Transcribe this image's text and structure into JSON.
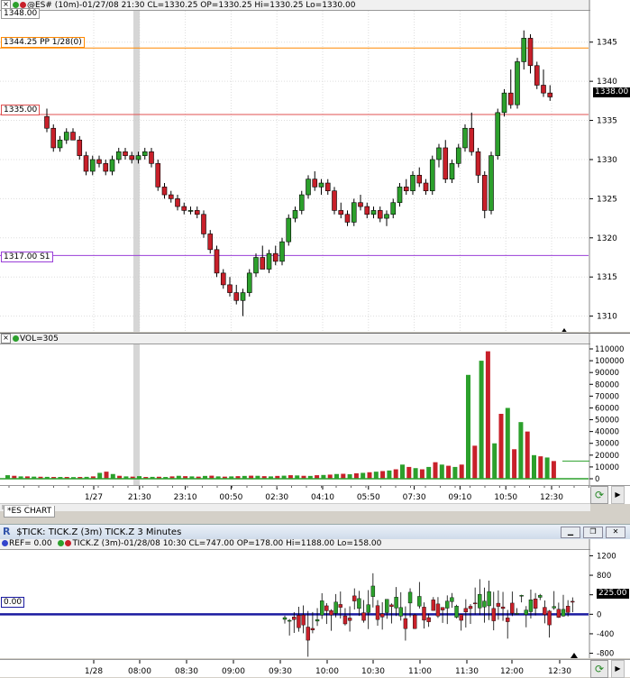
{
  "price_panel": {
    "top_label": "1348.00",
    "header": "@ES# (10m)-01/27/08 21:30 CL=1330.25 OP=1330.25 Hi=1330.25 Lo=1330.00",
    "pp_label": "1344.25 PP  1/28(0)",
    "l1335_label": "1335.00",
    "s1_label": "1317.00 S1",
    "current_price": "1338.00",
    "ticks": [
      "1345",
      "1340",
      "1335",
      "1330",
      "1325",
      "1320",
      "1315",
      "1310"
    ],
    "colors": {
      "up": "#2ca02c",
      "down": "#c8202a",
      "pp": "#ff8800",
      "level": "#e05050",
      "s1": "#9a3fd8"
    }
  },
  "volume_panel": {
    "header": "VOL=305",
    "ticks": [
      "110000",
      "100000",
      "90000",
      "80000",
      "70000",
      "60000",
      "50000",
      "40000",
      "30000",
      "20000",
      "10000",
      "0"
    ],
    "current": "15000"
  },
  "time_axis_1": [
    "1/27",
    "21:30",
    "23:10",
    "00:50",
    "02:30",
    "04:10",
    "05:50",
    "07:30",
    "09:10",
    "10:50",
    "12:30"
  ],
  "chart_tab": "*ES CHART",
  "tick_window": {
    "title": "$TICK: TICK.Z (3m) TICK.Z 3 Minutes",
    "header_ref": "REF= 0.00",
    "header": "TICK.Z (3m)-01/28/08 10:30 CL=747.00 OP=178.00 Hi=1188.00 Lo=158.00",
    "zero_label": "0.00",
    "current": "225.00",
    "ticks": [
      "1200",
      "800",
      "400",
      "0",
      "-400",
      "-800"
    ]
  },
  "time_axis_2": [
    "1/28",
    "08:00",
    "08:30",
    "09:00",
    "09:30",
    "10:00",
    "10:30",
    "11:00",
    "11:30",
    "12:00",
    "12:30"
  ],
  "chart_data": [
    {
      "type": "candlestick",
      "title": "@ES# (10m)",
      "ylim": [
        1308,
        1349
      ],
      "x_ticks": [
        "1/27",
        "21:30",
        "23:10",
        "00:50",
        "02:30",
        "04:10",
        "05:50",
        "07:30",
        "09:10",
        "10:50",
        "12:30"
      ],
      "series": [
        {
          "ohlc": [
            [
              1335.5,
              1336.5,
              1333.5,
              1334.0
            ],
            [
              1334.0,
              1334.5,
              1331.0,
              1331.5
            ],
            [
              1331.5,
              1333.0,
              1331.0,
              1332.5
            ],
            [
              1332.5,
              1334.0,
              1332.0,
              1333.5
            ],
            [
              1333.5,
              1334.0,
              1332.5,
              1332.5
            ],
            [
              1332.5,
              1333.0,
              1330.0,
              1330.5
            ],
            [
              1330.5,
              1331.0,
              1328.0,
              1328.5
            ],
            [
              1328.5,
              1330.5,
              1328.0,
              1330.0
            ],
            [
              1330.0,
              1330.5,
              1329.0,
              1329.5
            ],
            [
              1329.5,
              1330.0,
              1328.0,
              1328.5
            ],
            [
              1328.5,
              1330.5,
              1328.0,
              1330.0
            ],
            [
              1330.0,
              1331.5,
              1329.5,
              1331.0
            ],
            [
              1331.0,
              1331.5,
              1330.0,
              1330.5
            ],
            [
              1330.5,
              1331.0,
              1329.5,
              1330.0
            ],
            [
              1330.0,
              1331.0,
              1329.5,
              1330.5
            ],
            [
              1330.5,
              1331.5,
              1330.0,
              1331.0
            ],
            [
              1331.0,
              1331.5,
              1329.0,
              1329.5
            ],
            [
              1329.5,
              1330.0,
              1326.0,
              1326.5
            ],
            [
              1326.5,
              1327.0,
              1325.0,
              1325.5
            ],
            [
              1325.5,
              1326.0,
              1324.5,
              1325.0
            ],
            [
              1325.0,
              1325.5,
              1323.5,
              1324.0
            ],
            [
              1324.0,
              1324.5,
              1323.0,
              1323.5
            ],
            [
              1323.5,
              1324.0,
              1323.0,
              1323.5
            ],
            [
              1323.5,
              1324.0,
              1322.5,
              1323.0
            ],
            [
              1323.0,
              1323.5,
              1320.0,
              1320.5
            ],
            [
              1320.5,
              1321.0,
              1318.0,
              1318.5
            ],
            [
              1318.5,
              1319.0,
              1315.0,
              1315.5
            ],
            [
              1315.5,
              1316.0,
              1313.5,
              1314.0
            ],
            [
              1314.0,
              1315.0,
              1312.5,
              1313.0
            ],
            [
              1313.0,
              1314.0,
              1311.5,
              1312.0
            ],
            [
              1312.0,
              1313.5,
              1310.0,
              1313.0
            ],
            [
              1313.0,
              1316.0,
              1312.5,
              1315.5
            ],
            [
              1315.5,
              1318.0,
              1315.0,
              1317.5
            ],
            [
              1317.5,
              1319.0,
              1316.5,
              1316.0
            ],
            [
              1316.0,
              1318.5,
              1315.5,
              1318.0
            ],
            [
              1318.0,
              1319.0,
              1316.5,
              1317.0
            ],
            [
              1317.0,
              1320.0,
              1316.5,
              1319.5
            ],
            [
              1319.5,
              1323.0,
              1319.0,
              1322.5
            ],
            [
              1322.5,
              1324.0,
              1322.0,
              1323.5
            ],
            [
              1323.5,
              1326.0,
              1323.0,
              1325.5
            ],
            [
              1325.5,
              1328.0,
              1325.0,
              1327.5
            ],
            [
              1327.5,
              1328.5,
              1326.0,
              1326.5
            ],
            [
              1326.5,
              1327.5,
              1325.5,
              1327.0
            ],
            [
              1327.0,
              1327.5,
              1325.5,
              1326.0
            ],
            [
              1326.0,
              1326.5,
              1323.0,
              1323.5
            ],
            [
              1323.5,
              1324.5,
              1322.5,
              1323.0
            ],
            [
              1323.0,
              1323.5,
              1321.5,
              1322.0
            ],
            [
              1322.0,
              1325.0,
              1321.5,
              1324.5
            ],
            [
              1324.5,
              1325.5,
              1323.5,
              1324.0
            ],
            [
              1324.0,
              1324.5,
              1322.5,
              1323.0
            ],
            [
              1323.0,
              1324.0,
              1322.5,
              1323.5
            ],
            [
              1323.5,
              1324.0,
              1322.0,
              1322.5
            ],
            [
              1322.5,
              1323.5,
              1321.5,
              1323.0
            ],
            [
              1323.0,
              1325.0,
              1322.5,
              1324.5
            ],
            [
              1324.5,
              1327.0,
              1324.0,
              1326.5
            ],
            [
              1326.5,
              1327.5,
              1325.5,
              1326.0
            ],
            [
              1326.0,
              1328.5,
              1325.5,
              1328.0
            ],
            [
              1328.0,
              1329.0,
              1326.5,
              1327.0
            ],
            [
              1327.0,
              1327.5,
              1325.5,
              1326.0
            ],
            [
              1326.0,
              1330.5,
              1325.5,
              1330.0
            ],
            [
              1330.0,
              1332.0,
              1329.0,
              1331.5
            ],
            [
              1331.5,
              1332.5,
              1327.0,
              1327.5
            ],
            [
              1327.5,
              1330.0,
              1327.0,
              1329.5
            ],
            [
              1329.5,
              1332.0,
              1329.0,
              1331.5
            ],
            [
              1331.5,
              1334.5,
              1331.0,
              1334.0
            ],
            [
              1334.0,
              1336.0,
              1330.5,
              1331.0
            ],
            [
              1331.0,
              1331.5,
              1327.0,
              1328.0
            ],
            [
              1328.0,
              1328.5,
              1322.5,
              1323.5
            ],
            [
              1323.5,
              1331.0,
              1323.0,
              1330.5
            ],
            [
              1330.5,
              1336.5,
              1330.0,
              1336.0
            ],
            [
              1336.0,
              1339.0,
              1335.5,
              1338.5
            ],
            [
              1338.5,
              1341.5,
              1336.5,
              1337.0
            ],
            [
              1337.0,
              1343.0,
              1336.5,
              1342.5
            ],
            [
              1342.5,
              1346.5,
              1341.5,
              1345.5
            ],
            [
              1345.5,
              1346.0,
              1341.0,
              1342.0
            ],
            [
              1342.0,
              1342.5,
              1339.0,
              1339.5
            ],
            [
              1339.5,
              1341.5,
              1338.0,
              1338.5
            ],
            [
              1338.5,
              1339.5,
              1337.5,
              1338.0
            ]
          ]
        }
      ]
    },
    {
      "type": "bar",
      "title": "VOL",
      "ylim": [
        0,
        110000
      ],
      "series": [
        {
          "values": [
            3000,
            2500,
            2000,
            2000,
            1800,
            1700,
            1600,
            1500,
            1500,
            1500,
            1400,
            1500,
            1600,
            2000,
            5000,
            6000,
            4000,
            2500,
            2000,
            1800,
            2200,
            1500,
            1600,
            1700,
            1500,
            2000,
            2500,
            2200,
            2000,
            1800,
            2400,
            2600,
            2000,
            1800,
            2000,
            2200,
            2400,
            2600,
            2500,
            2200,
            2000,
            2400,
            2600,
            3000,
            2800,
            2500,
            2400,
            3000,
            3200,
            3500,
            4000,
            4200,
            3800,
            4600,
            5000,
            5500,
            6000,
            6500,
            7000,
            8000,
            12000,
            10000,
            9000,
            8000,
            10000,
            14000,
            12000,
            11000,
            10000,
            12000,
            88000,
            28000,
            100000,
            108000,
            30000,
            55000,
            60000,
            25000,
            48000,
            40000,
            20000,
            19000,
            18000,
            15000
          ]
        }
      ]
    },
    {
      "type": "candlestick",
      "title": "TICK.Z (3m)",
      "ylim": [
        -900,
        1300
      ],
      "x_ticks": [
        "1/28",
        "08:00",
        "08:30",
        "09:00",
        "09:30",
        "10:00",
        "10:30",
        "11:00",
        "11:30",
        "12:00",
        "12:30"
      ],
      "reference_line": 0
    }
  ]
}
